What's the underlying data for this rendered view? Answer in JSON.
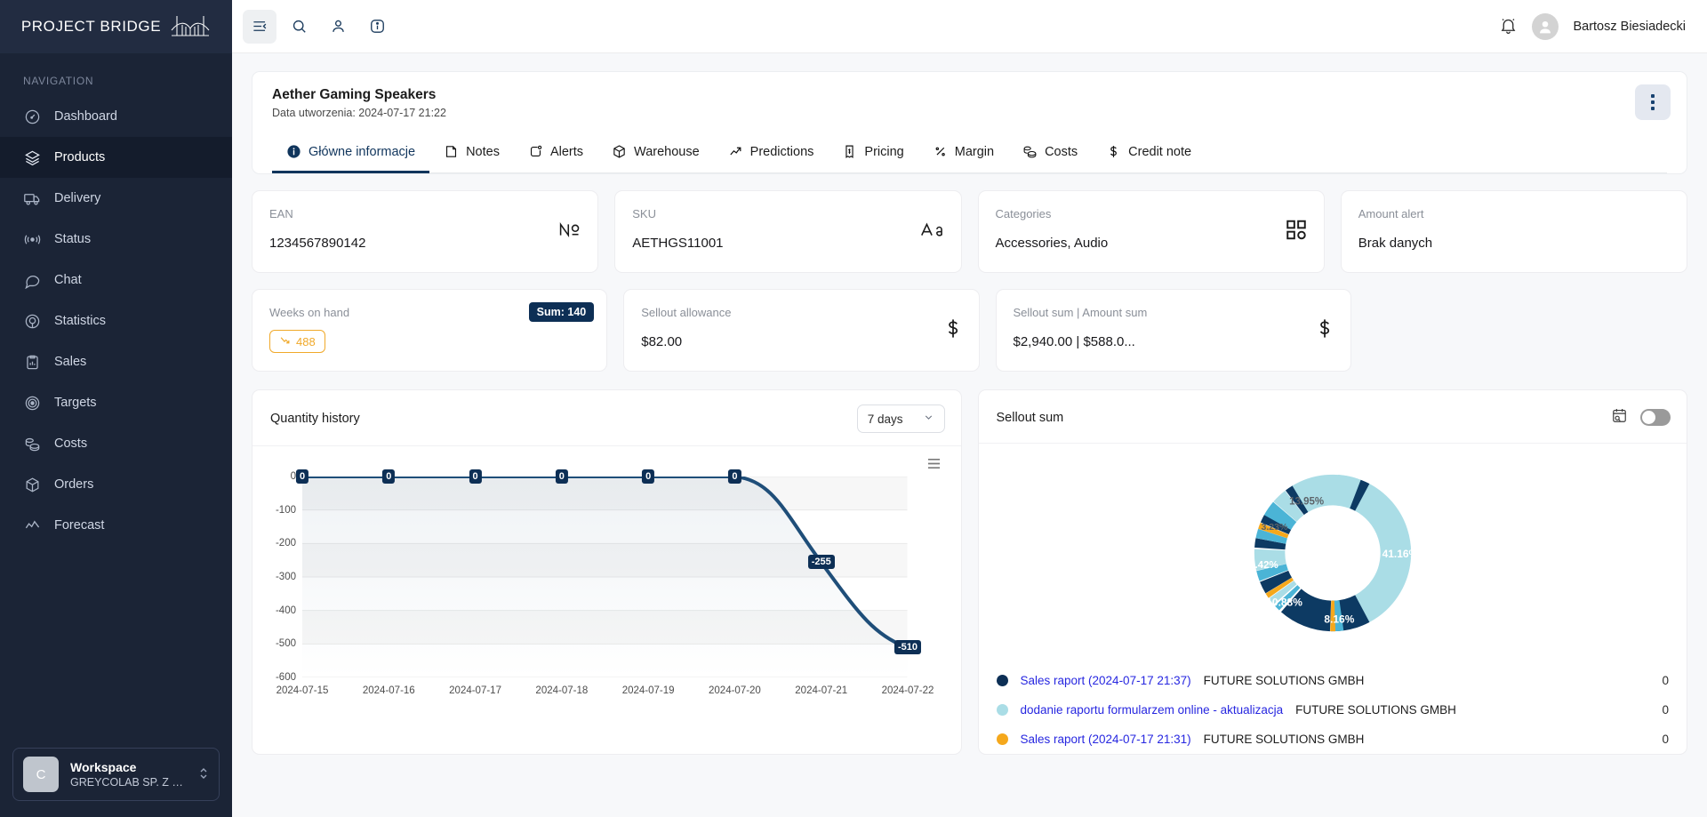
{
  "brand": {
    "name": "PROJECT BRIDGE",
    "logo_icon": "bridge-icon"
  },
  "sidebar": {
    "nav_label": "NAVIGATION",
    "items": [
      {
        "label": "Dashboard",
        "icon": "gauge-icon",
        "active": false
      },
      {
        "label": "Products",
        "icon": "layers-icon",
        "active": true
      },
      {
        "label": "Delivery",
        "icon": "truck-icon",
        "active": false
      },
      {
        "label": "Status",
        "icon": "broadcast-icon",
        "active": false
      },
      {
        "label": "Chat",
        "icon": "chat-bubble-icon",
        "active": false
      },
      {
        "label": "Statistics",
        "icon": "target-circle-icon",
        "active": false
      },
      {
        "label": "Sales",
        "icon": "clipboard-chart-icon",
        "active": false
      },
      {
        "label": "Targets",
        "icon": "bullseye-icon",
        "active": false
      },
      {
        "label": "Costs",
        "icon": "coins-icon",
        "active": false
      },
      {
        "label": "Orders",
        "icon": "box-icon",
        "active": false
      },
      {
        "label": "Forecast",
        "icon": "trend-line-icon",
        "active": false
      }
    ],
    "workspace": {
      "avatar_letter": "C",
      "title": "Workspace",
      "subtitle": "GREYCOLAB SP. Z O....",
      "chevron_icon": "chevron-updown-icon"
    }
  },
  "topbar": {
    "menu_icon": "collapse-menu-icon",
    "search_icon": "search-icon",
    "user_icon": "person-icon",
    "info_icon": "info-circle-icon",
    "bell_icon": "bell-icon",
    "avatar_icon": "avatar-icon",
    "user_name": "Bartosz Biesiadecki"
  },
  "product": {
    "title": "Aether Gaming Speakers",
    "created": "Data utworzenia: 2024-07-17 21:22",
    "kebab_icon": "more-vertical-icon"
  },
  "tabs": [
    {
      "label": "Główne informacje",
      "icon": "info-circle-icon",
      "active": true
    },
    {
      "label": "Notes",
      "icon": "note-icon",
      "active": false
    },
    {
      "label": "Alerts",
      "icon": "alert-icon",
      "active": false
    },
    {
      "label": "Warehouse",
      "icon": "box-icon",
      "active": false
    },
    {
      "label": "Predictions",
      "icon": "trend-up-icon",
      "active": false
    },
    {
      "label": "Pricing",
      "icon": "receipt-icon",
      "active": false
    },
    {
      "label": "Margin",
      "icon": "percent-icon",
      "active": false
    },
    {
      "label": "Costs",
      "icon": "coins-icon",
      "active": false
    },
    {
      "label": "Credit note",
      "icon": "dollar-icon",
      "active": false
    }
  ],
  "cards_row1": [
    {
      "label": "EAN",
      "value": "1234567890142",
      "icon": "numero-icon"
    },
    {
      "label": "SKU",
      "value": "AETHGS11001",
      "icon": "font-size-icon"
    },
    {
      "label": "Categories",
      "value": "Accessories, Audio",
      "icon": "grid-icon"
    },
    {
      "label": "Amount alert",
      "value": "Brak danych",
      "icon": "status-dot-icon"
    }
  ],
  "cards_row2": [
    {
      "label": "Weeks on hand",
      "value": "488",
      "badge": "Sum: 140",
      "trend_icon": "trend-down-icon"
    },
    {
      "label": "Sellout allowance",
      "value": "$82.00",
      "icon": "dollar-icon"
    },
    {
      "label": "Sellout sum | Amount sum",
      "value": "$2,940.00 | $588.0...",
      "icon": "dollar-icon"
    }
  ],
  "quantity_panel": {
    "title": "Quantity history",
    "range_value": "7 days",
    "chevron_icon": "chevron-down-icon",
    "menu_icon": "hamburger-menu-icon"
  },
  "sellout_panel": {
    "title": "Sellout sum",
    "calendar_icon": "calendar-search-icon",
    "toggle_icon": "toggle-off-icon"
  },
  "chart_data": [
    {
      "type": "line",
      "title": "Quantity history",
      "x": [
        "2024-07-15",
        "2024-07-16",
        "2024-07-17",
        "2024-07-18",
        "2024-07-19",
        "2024-07-20",
        "2024-07-21",
        "2024-07-22"
      ],
      "values": [
        0,
        0,
        0,
        0,
        0,
        0,
        -255,
        -510
      ],
      "point_labels": [
        "0",
        "0",
        "0",
        "0",
        "0",
        "0",
        "-255",
        "-510"
      ],
      "ylabel": "",
      "xlabel": "",
      "yticks": [
        0,
        -100,
        -200,
        -300,
        -400,
        -500,
        -600
      ],
      "ylim": [
        -600,
        0
      ],
      "grid": true,
      "legend": "none",
      "series_color": "#1f4e79"
    },
    {
      "type": "pie",
      "title": "Sellout sum",
      "labels": [
        "41.16%",
        "13.95%",
        "3.23%",
        "4.42%",
        "10.88%",
        "8.16%"
      ],
      "values": [
        41.16,
        13.95,
        3.23,
        4.42,
        10.88,
        8.16
      ],
      "colors": [
        "#aadde6",
        "#aadde6",
        "#4bb4d6",
        "#aadde6",
        "#0d3a63",
        "#0d3a63"
      ],
      "donut": true,
      "legend_position": "bottom",
      "legend_entries": [
        {
          "color": "#0d2f55",
          "name": "Sales raport (2024-07-17 21:37)",
          "company": "FUTURE SOLUTIONS GMBH",
          "value": "0"
        },
        {
          "color": "#aadde6",
          "name": "dodanie raportu formularzem online - aktualizacja",
          "company": "FUTURE SOLUTIONS GMBH",
          "value": "0"
        },
        {
          "color": "#f5a81c",
          "name": "Sales raport (2024-07-17 21:31)",
          "company": "FUTURE SOLUTIONS GMBH",
          "value": "0"
        }
      ]
    }
  ]
}
